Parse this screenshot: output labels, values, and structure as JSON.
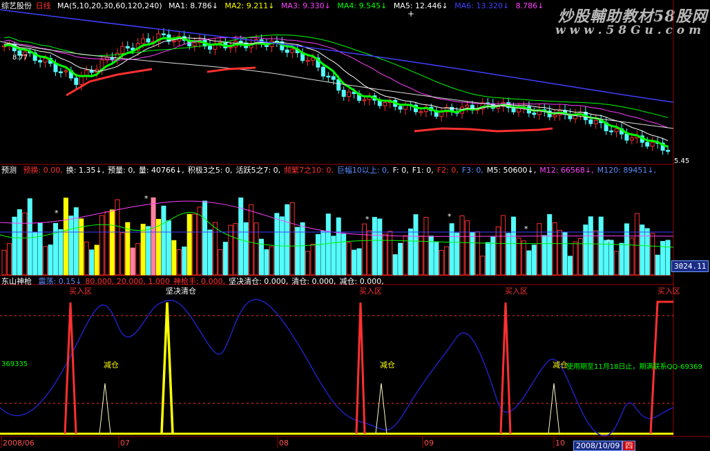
{
  "header": {
    "stock_name": "综艺股份",
    "mode": "日线",
    "ma_params": "MA(5,10,20,30,60,120,240)",
    "ma1": "MA1: 8.786↓",
    "ma2": "MA2: 9.211↓",
    "ma3": "MA3: 9.330↓",
    "ma4": "MA4: 9.545↓",
    "ma5": "MA5: 12.446↓",
    "ma6": "MA6: 13.320↓",
    "ma7": "8.786↓",
    "watermark_title": "炒股輔助教材58股网",
    "watermark_url": "w w w . 5 8 G u . c o m"
  },
  "panel1": {
    "left_price": "8.77",
    "right_price": "5.45"
  },
  "panel2": {
    "title": "预测",
    "items": [
      {
        "text": "预换: 0.00,",
        "color": "#ff3030"
      },
      {
        "text": "换: 1.35↓,",
        "color": "#ffffff"
      },
      {
        "text": "预量: 0,",
        "color": "#ffffff"
      },
      {
        "text": "量: 40766↓,",
        "color": "#ffffff"
      },
      {
        "text": "积极3之5: 0,",
        "color": "#ffffff"
      },
      {
        "text": "活跃5之7: 0,",
        "color": "#ffffff"
      },
      {
        "text": "频繁7之10: 0,",
        "color": "#ff3030"
      },
      {
        "text": "巨幅10以上: 0,",
        "color": "#5b8cff"
      },
      {
        "text": "F: 0,",
        "color": "#ffffff"
      },
      {
        "text": "F1: 0,",
        "color": "#ffffff"
      },
      {
        "text": "F2: 0,",
        "color": "#ff3030"
      },
      {
        "text": "F3: 0,",
        "color": "#5b8cff"
      },
      {
        "text": "M5: 50600↓,",
        "color": "#ffffff"
      },
      {
        "text": "M12: 66568↓,",
        "color": "#ff40ff"
      },
      {
        "text": "M120: 89451↓,",
        "color": "#5b8cff"
      }
    ],
    "price_badge": "3024.11"
  },
  "panel3": {
    "title": "东山神枪",
    "items": [
      {
        "text": "震荡: 0.15↓",
        "color": "#5b8cff"
      },
      {
        "text": "80.000, 20.000, 1.000",
        "color": "#ff3030"
      },
      {
        "text": "神枪手: 0.000,",
        "color": "#ff3030"
      },
      {
        "text": "坚决清仓: 0.000,",
        "color": "#ffffff"
      },
      {
        "text": "清仓: 0.000,",
        "color": "#ffffff"
      },
      {
        "text": "减仓: 0.000,",
        "color": "#ffffff"
      }
    ],
    "left_value": "369335",
    "notice": "使用期至11月18日止，期满联系QQ-69369"
  },
  "annotations": {
    "buy_zone": "买入区",
    "sell_all_firm": "坚决清仓",
    "reduce": "减仓",
    "star": "*"
  },
  "xaxis": {
    "d1": "2008/06",
    "d2": "07",
    "d3": "08",
    "d4": "09",
    "d5": "10",
    "cursor_date": "2008/10/09",
    "cursor_day": "四"
  },
  "colors": {
    "up": "#ff3030",
    "down": "#54fcfc",
    "ma_green": "#00ff00",
    "ma_magenta": "#ff40ff",
    "ma_blue": "#4040ff",
    "ma_white": "#ffffff",
    "yellow": "#ffff00"
  }
}
